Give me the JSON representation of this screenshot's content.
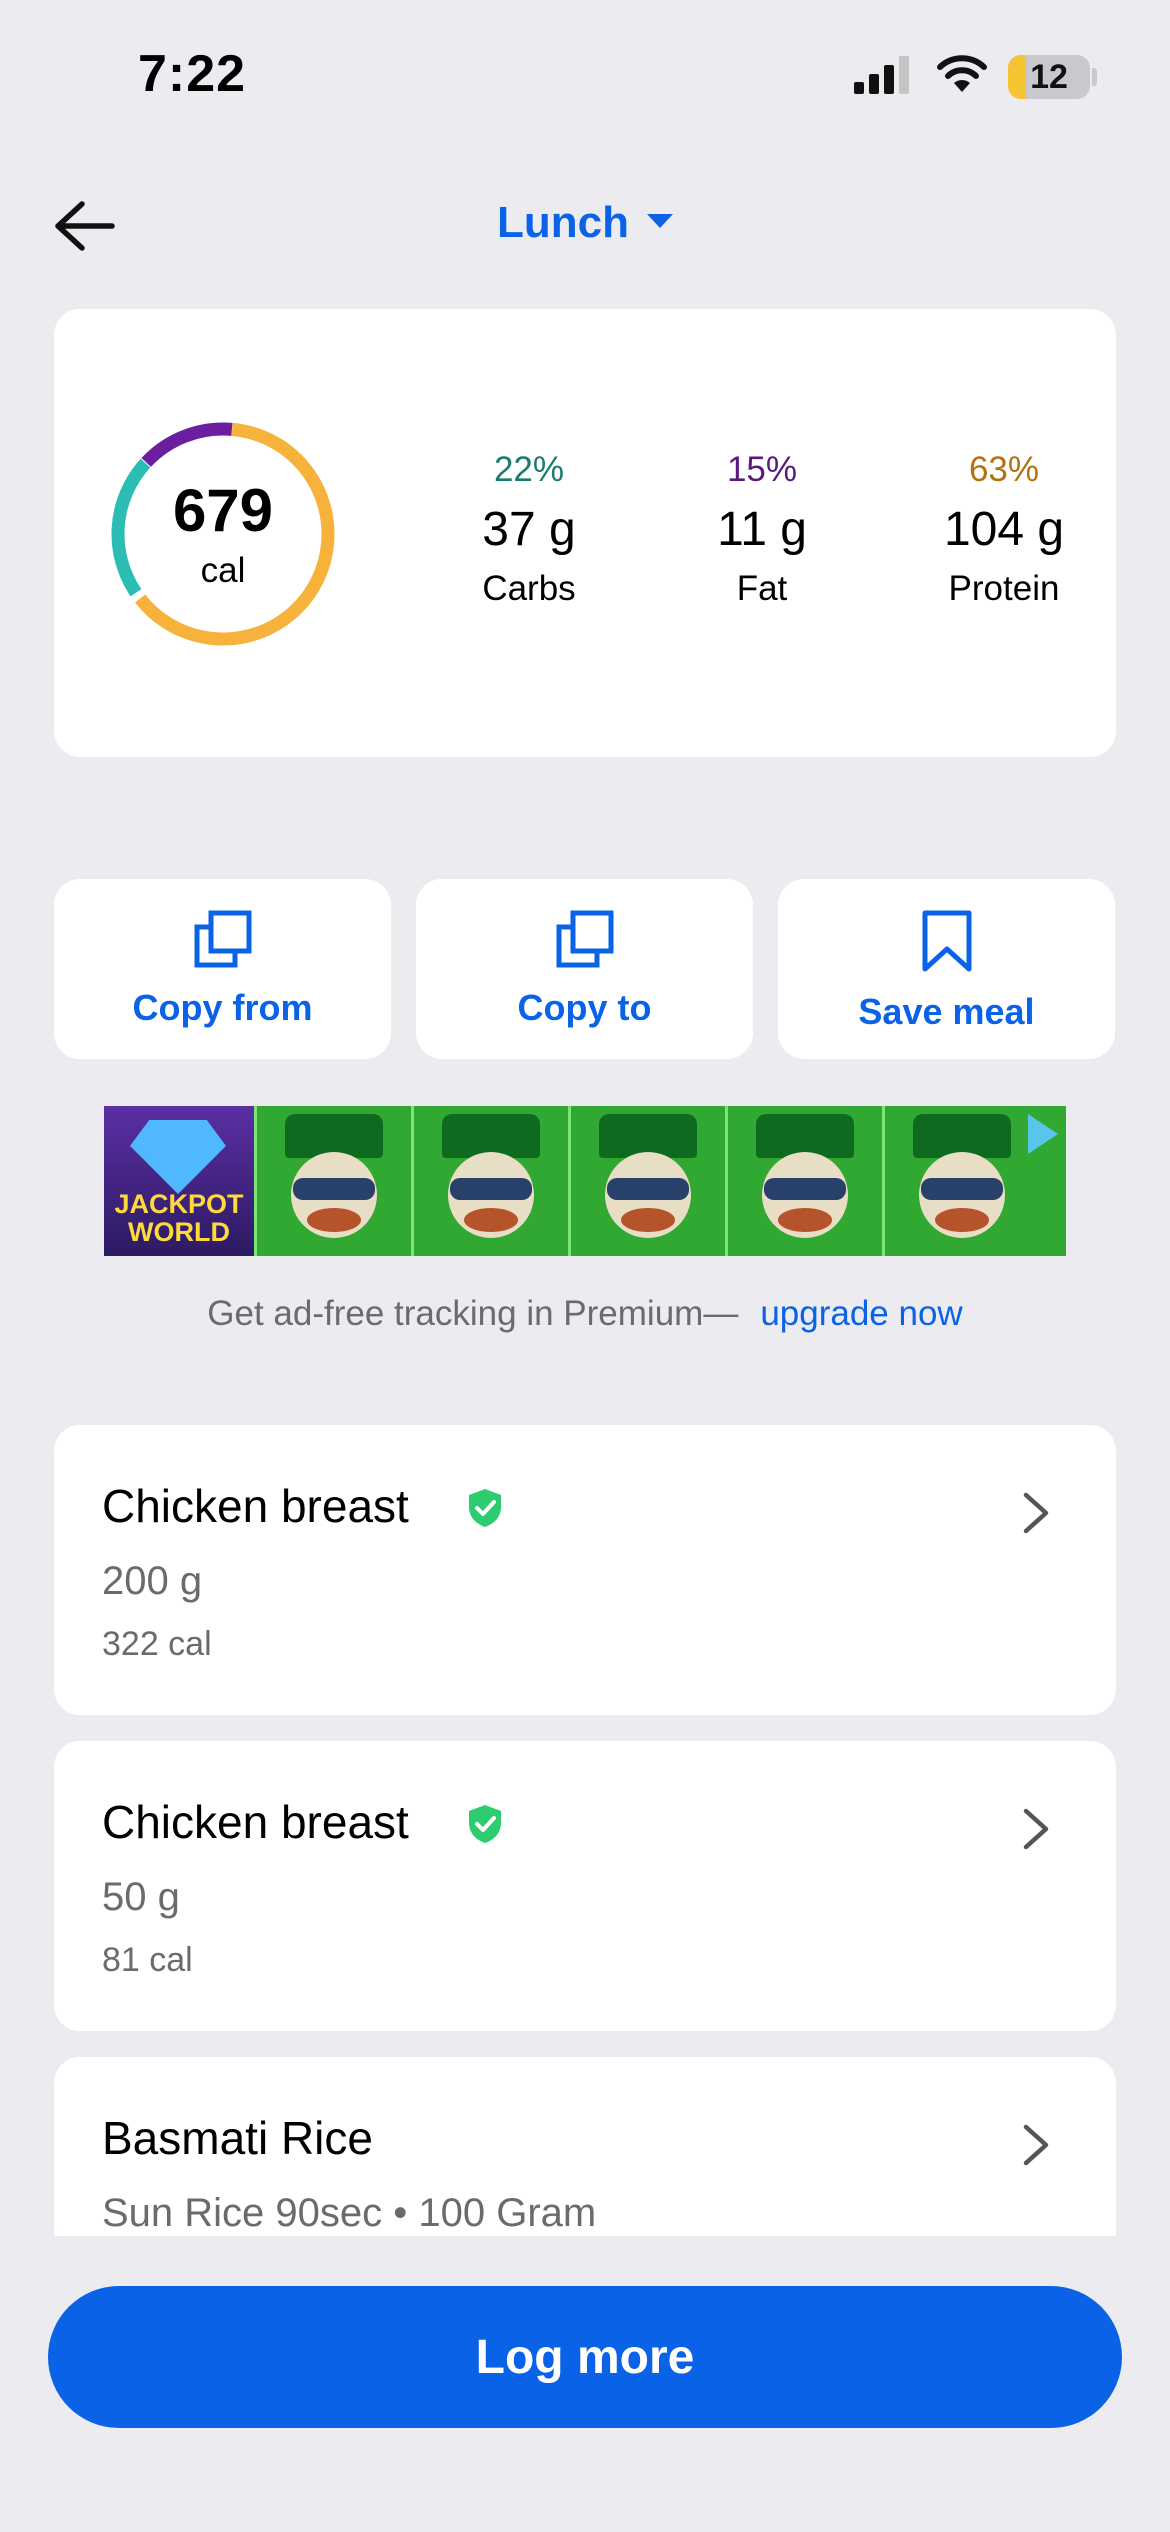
{
  "status_bar": {
    "time": "7:22",
    "battery": "12"
  },
  "header": {
    "title": "Lunch"
  },
  "summary": {
    "calories": "679",
    "calories_unit": "cal",
    "macros": [
      {
        "pct": "22%",
        "grams": "37 g",
        "name": "Carbs",
        "color": "#1a7b6e"
      },
      {
        "pct": "15%",
        "grams": "11 g",
        "name": "Fat",
        "color": "#5a1a7d"
      },
      {
        "pct": "63%",
        "grams": "104 g",
        "name": "Protein",
        "color": "#b5700f"
      }
    ],
    "ring_colors": {
      "carbs": "#2bbdb4",
      "fat": "#6b1fa0",
      "protein": "#f7b23b"
    }
  },
  "actions": [
    {
      "label": "Copy from",
      "icon": "copy-icon"
    },
    {
      "label": "Copy to",
      "icon": "copy-icon"
    },
    {
      "label": "Save meal",
      "icon": "bookmark-icon"
    }
  ],
  "ad": {
    "brand_text": "JACKPOT WORLD"
  },
  "promo": {
    "text": "Get ad-free tracking in Premium—",
    "link": "upgrade now"
  },
  "foods": [
    {
      "name": "Chicken breast",
      "verified": true,
      "amount": "200 g",
      "calories": "322 cal"
    },
    {
      "name": "Chicken breast",
      "verified": true,
      "amount": "50 g",
      "calories": "81 cal"
    },
    {
      "name": "Basmati Rice",
      "verified": false,
      "amount": "Sun Rice 90sec • 100 Gram",
      "calories": ""
    }
  ],
  "footer": {
    "log_more": "Log more"
  },
  "colors": {
    "accent": "#0a63e6",
    "background": "#ebebf0",
    "verified_badge": "#2ecc71"
  }
}
